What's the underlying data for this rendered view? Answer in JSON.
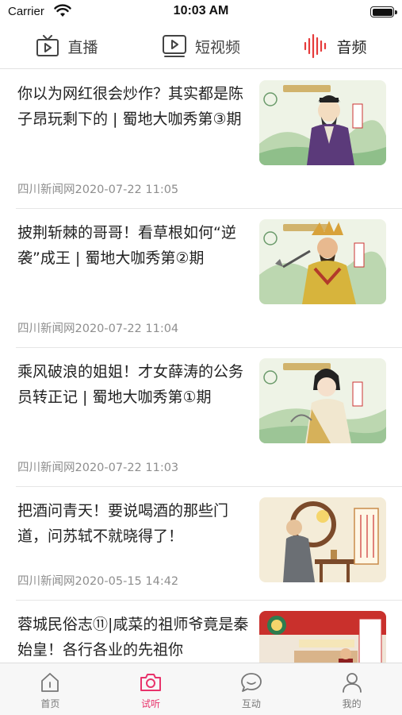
{
  "status_bar": {
    "carrier": "Carrier",
    "time": "10:03 AM"
  },
  "top_tabs": [
    {
      "label": "直播",
      "icon": "tv-icon"
    },
    {
      "label": "短视频",
      "icon": "video-icon"
    },
    {
      "label": "音频",
      "icon": "audio-wave-icon",
      "active": true
    }
  ],
  "news": [
    {
      "title": "你以为网红很会炒作？其实都是陈子昂玩剩下的 | 蜀地大咖秀第③期",
      "meta": "四川新闻网2020-07-22 11:05",
      "thumb": "scholar-illustration"
    },
    {
      "title": "披荆斩棘的哥哥！看草根如何“逆袭”成王 | 蜀地大咖秀第②期",
      "meta": "四川新闻网2020-07-22 11:04",
      "thumb": "warrior-king-illustration"
    },
    {
      "title": " 乘风破浪的姐姐！才女薛涛的公务员转正记 | 蜀地大咖秀第①期",
      "meta": "四川新闻网2020-07-22 11:03",
      "thumb": "lady-poet-illustration"
    },
    {
      "title": "把酒问青天！要说喝酒的那些门道，问苏轼不就晓得了！",
      "meta": "四川新闻网2020-05-15 14:42",
      "thumb": "wine-poet-illustration"
    },
    {
      "title": "蓉城民俗志⑪|咸菜的祖师爷竟是秦始皇！各行各业的先祖你",
      "meta": "",
      "thumb": "folk-custom-illustration"
    }
  ],
  "bottom_tabs": [
    {
      "label": "首页",
      "icon": "home-icon"
    },
    {
      "label": "试听",
      "icon": "camera-icon",
      "active": true
    },
    {
      "label": "互动",
      "icon": "chat-bubble-icon"
    },
    {
      "label": "我的",
      "icon": "person-icon"
    }
  ],
  "colors": {
    "accent": "#e8336b",
    "tab_icon": "#444444",
    "audio_icon": "#e63b3b",
    "meta_text": "#8e8e8e"
  }
}
